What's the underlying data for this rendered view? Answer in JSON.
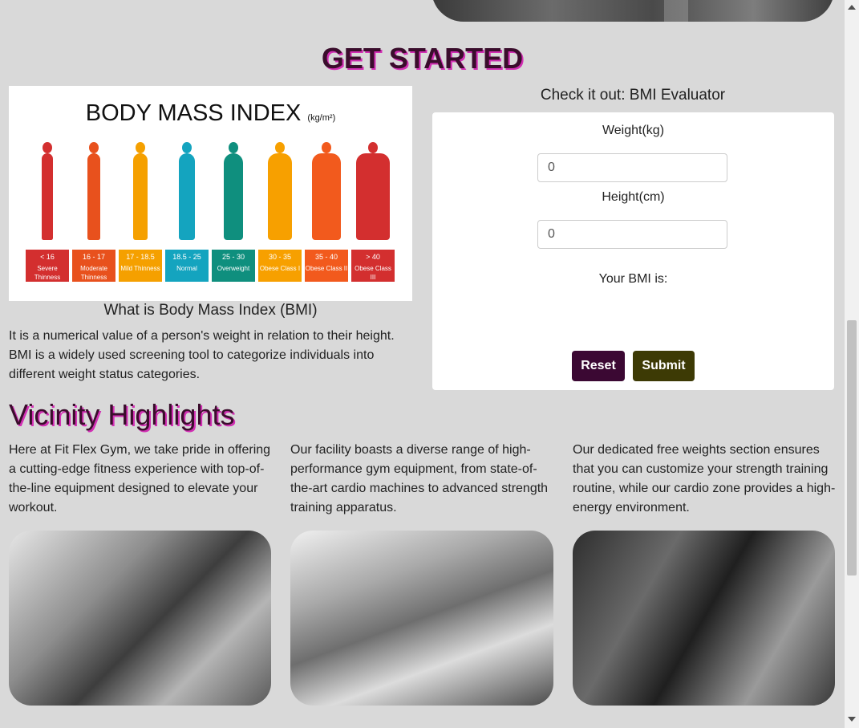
{
  "get_started": {
    "heading": "GET STARTED"
  },
  "bmi_chart": {
    "title": "BODY MASS INDEX",
    "unit": "(kg/m²)",
    "bands": [
      {
        "range": "< 16",
        "label": "Severe Thinness",
        "color": "#d32f2f"
      },
      {
        "range": "16 - 17",
        "label": "Moderate Thinness",
        "color": "#e8511d"
      },
      {
        "range": "17 - 18.5",
        "label": "Mild Thinness",
        "color": "#f5a000"
      },
      {
        "range": "18.5 - 25",
        "label": "Normal",
        "color": "#14a4bf"
      },
      {
        "range": "25 - 30",
        "label": "Overweight",
        "color": "#0f8f7e"
      },
      {
        "range": "30 - 35",
        "label": "Obese Class I",
        "color": "#f7a000"
      },
      {
        "range": "35 - 40",
        "label": "Obese Class II",
        "color": "#f25a1d"
      },
      {
        "range": "> 40",
        "label": "Obese Class III",
        "color": "#d32f2f"
      }
    ],
    "caption": "What is Body Mass Index (BMI)",
    "description": "It is a numerical value of a person's weight in relation to their height. BMI is a widely used screening tool to categorize individuals into different weight status categories."
  },
  "evaluator": {
    "title": "Check it out: BMI Evaluator",
    "weight_label": "Weight(kg)",
    "weight_value": "0",
    "height_label": "Height(cm)",
    "height_value": "0",
    "result_label": "Your BMI is:",
    "reset_label": "Reset",
    "submit_label": "Submit",
    "colors": {
      "reset": "#3b0833",
      "submit": "#3d3a05"
    }
  },
  "vicinity": {
    "heading": "Vicinity Highlights",
    "columns": [
      {
        "text": "Here at Fit Flex Gym, we take pride in offering a cutting-edge fitness experience with top-of-the-line equipment designed to elevate your workout."
      },
      {
        "text": "Our facility boasts a diverse range of high-performance gym equipment, from state-of-the-art cardio machines to advanced strength training apparatus."
      },
      {
        "text": "Our dedicated free weights section ensures that you can customize your strength training routine, while our cardio zone provides a high-energy environment."
      }
    ]
  },
  "colors": {
    "heading": "#3a0d2c",
    "heading_shadow": "#d22fb4",
    "page_bg": "#d9d9d9"
  }
}
